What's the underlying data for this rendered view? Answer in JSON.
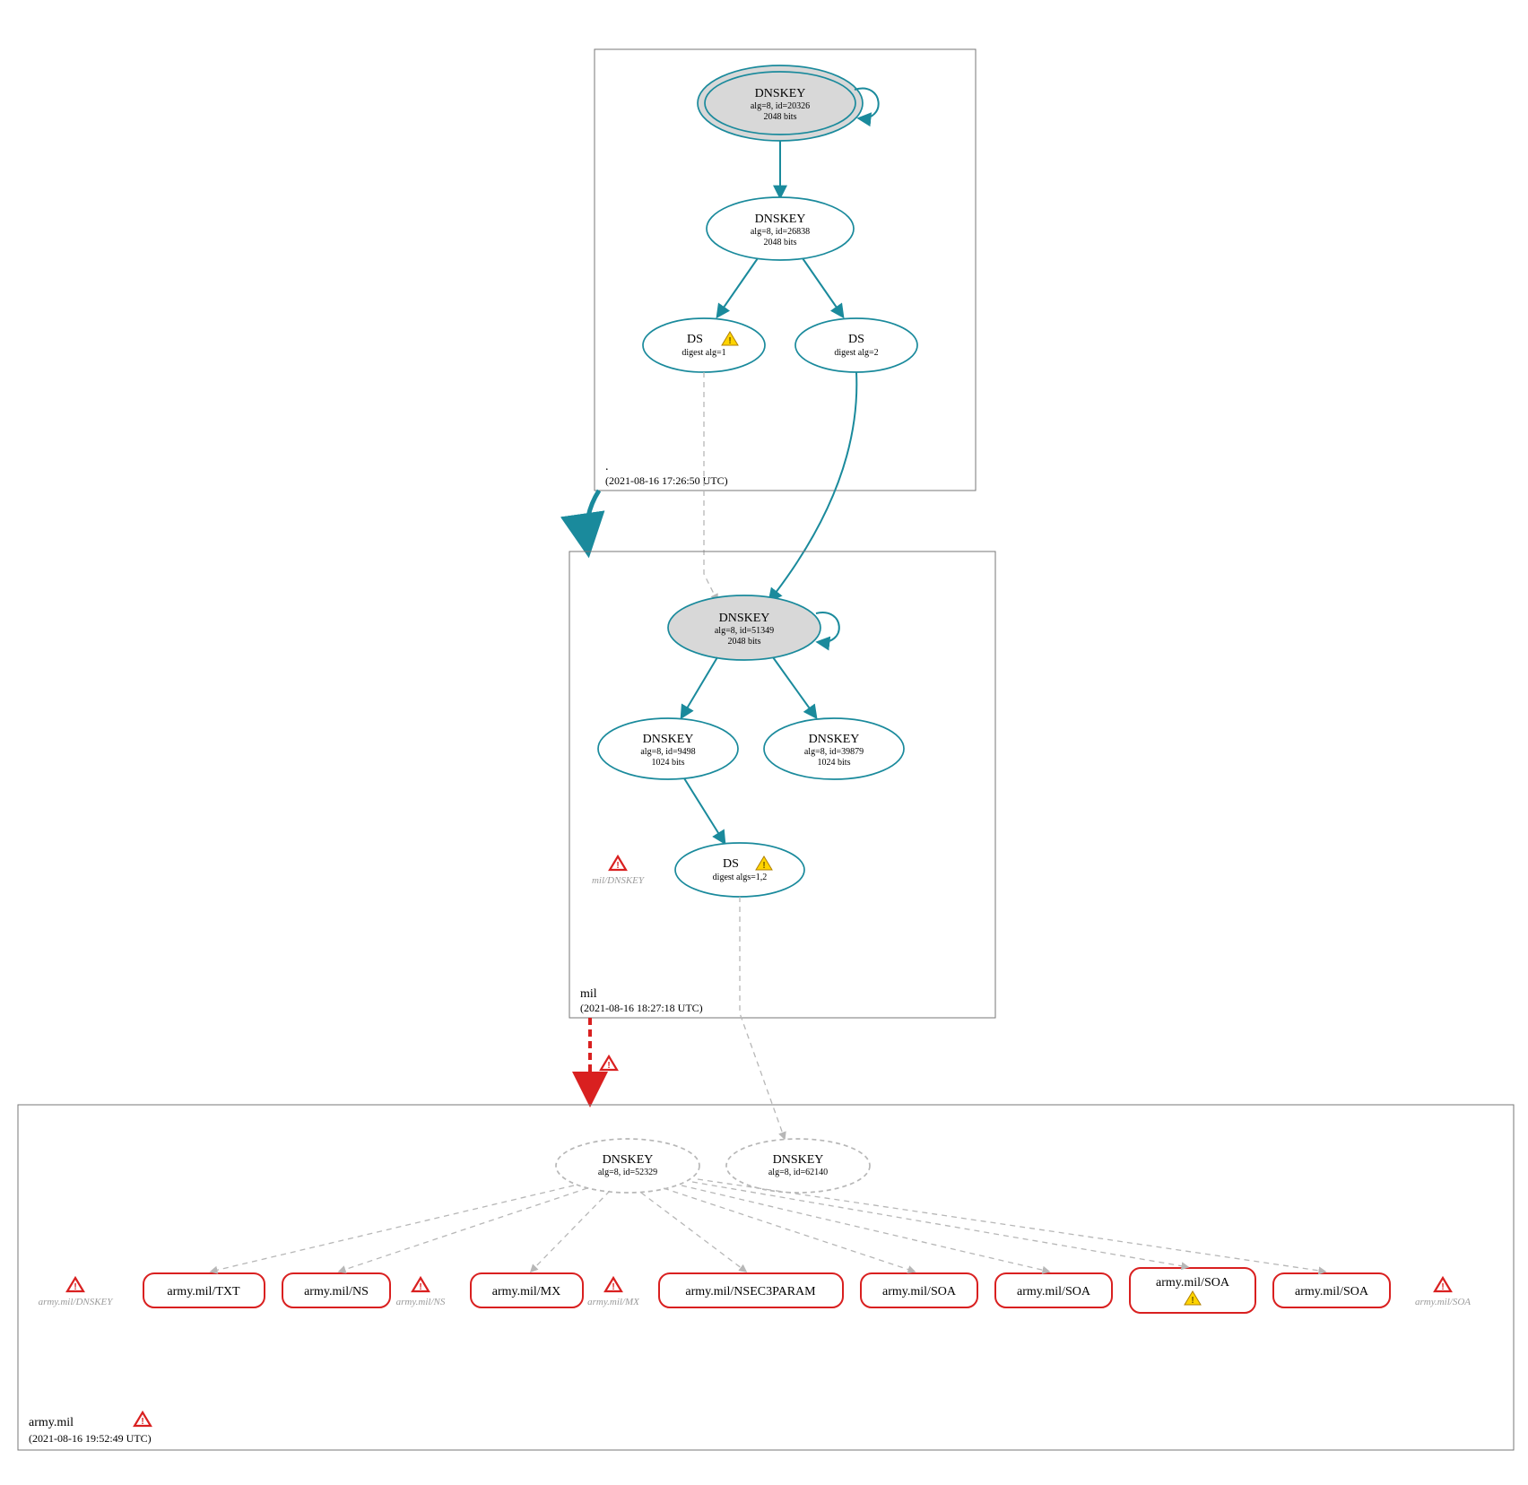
{
  "zones": {
    "root": {
      "name": ".",
      "timestamp": "(2021-08-16 17:26:50 UTC)"
    },
    "mil": {
      "name": "mil",
      "timestamp": "(2021-08-16 18:27:18 UTC)"
    },
    "army": {
      "name": "army.mil",
      "timestamp": "(2021-08-16 19:52:49 UTC)"
    }
  },
  "nodes": {
    "rootKSK": {
      "title": "DNSKEY",
      "sub1": "alg=8, id=20326",
      "sub2": "2048 bits"
    },
    "rootZSK": {
      "title": "DNSKEY",
      "sub1": "alg=8, id=26838",
      "sub2": "2048 bits"
    },
    "rootDS1": {
      "title": "DS",
      "sub1": "digest alg=1"
    },
    "rootDS2": {
      "title": "DS",
      "sub1": "digest alg=2"
    },
    "milKSK": {
      "title": "DNSKEY",
      "sub1": "alg=8, id=51349",
      "sub2": "2048 bits"
    },
    "milZSK1": {
      "title": "DNSKEY",
      "sub1": "alg=8, id=9498",
      "sub2": "1024 bits"
    },
    "milZSK2": {
      "title": "DNSKEY",
      "sub1": "alg=8, id=39879",
      "sub2": "1024 bits"
    },
    "milDS": {
      "title": "DS",
      "sub1": "digest algs=1,2"
    },
    "milErrLbl": "mil/DNSKEY",
    "armyKey1": {
      "title": "DNSKEY",
      "sub1": "alg=8, id=52329"
    },
    "armyKey2": {
      "title": "DNSKEY",
      "sub1": "alg=8, id=62140"
    }
  },
  "rrsets": [
    "army.mil/TXT",
    "army.mil/NS",
    "army.mil/MX",
    "army.mil/NSEC3PARAM",
    "army.mil/SOA",
    "army.mil/SOA",
    "army.mil/SOA",
    "army.mil/SOA"
  ],
  "errLabels": [
    "army.mil/DNSKEY",
    "army.mil/NS",
    "army.mil/MX",
    "army.mil/SOA"
  ]
}
